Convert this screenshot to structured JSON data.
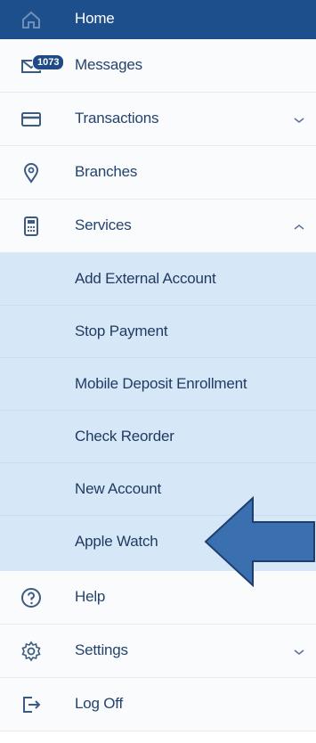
{
  "menu": {
    "home": "Home",
    "messages": "Messages",
    "messages_badge": "1073",
    "transactions": "Transactions",
    "branches": "Branches",
    "services": "Services",
    "services_sub": [
      "Add External Account",
      "Stop Payment",
      "Mobile Deposit Enrollment",
      "Check Reorder",
      "New Account",
      "Apple Watch"
    ],
    "help": "Help",
    "settings": "Settings",
    "log_off": "Log Off"
  },
  "colors": {
    "nav_header": "#1d4f8d",
    "submenu_bg": "#d6e8f8",
    "arrow": "#3a6fb0",
    "text": "#24436e"
  },
  "icons": [
    "home-icon",
    "envelope-icon",
    "card-icon",
    "location-pin-icon",
    "calculator-icon",
    "question-icon",
    "gear-icon",
    "logout-icon"
  ]
}
